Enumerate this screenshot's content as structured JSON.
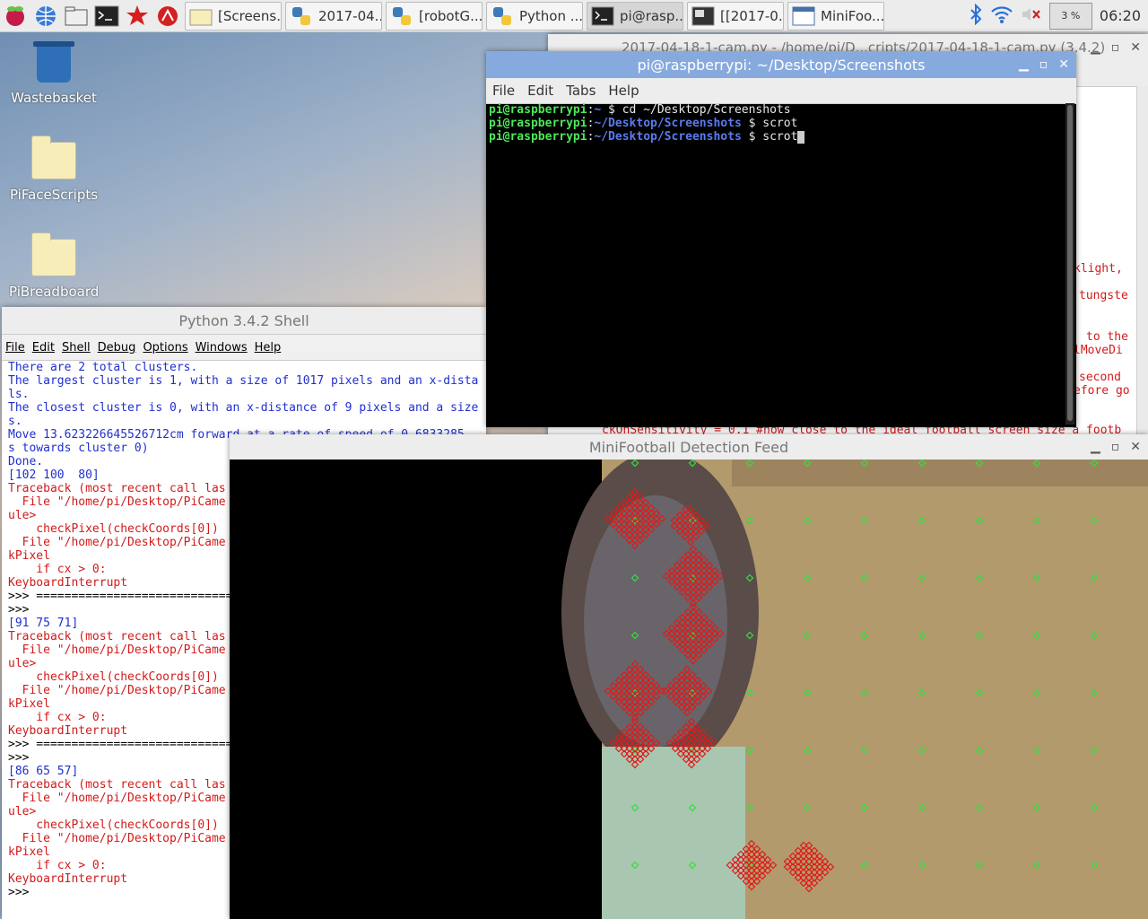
{
  "taskbar": {
    "tasks": [
      {
        "label": "[Screens...",
        "icon": "folder-icon"
      },
      {
        "label": "2017-04...",
        "icon": "python-icon"
      },
      {
        "label": "[robotG...",
        "icon": "python-icon"
      },
      {
        "label": "Python ...",
        "icon": "python-icon"
      },
      {
        "label": "pi@rasp...",
        "icon": "terminal-icon"
      },
      {
        "label": "[[2017-0...",
        "icon": "image-icon"
      },
      {
        "label": "MiniFoo...",
        "icon": "window-icon"
      }
    ],
    "cpu": "3 %",
    "clock": "06:20"
  },
  "desktop": {
    "icons": [
      {
        "label": "Wastebasket"
      },
      {
        "label": "PiFaceScripts"
      },
      {
        "label": "PiBreadboard"
      }
    ]
  },
  "editor": {
    "title": "2017-04-18-1-cam.py - /home/pi/D...cripts/2017-04-18-1-cam.py (3.4.2)",
    "visible_fragments": [
      "klight,",
      "tungste",
      "to the",
      "lMoveDi",
      "second",
      "efore go"
    ],
    "bottom_line": "ckOnSensitivity = 0.1 #now close to the ideal football screen size a footb"
  },
  "terminal": {
    "title": "pi@raspberrypi: ~/Desktop/Screenshots",
    "menu": [
      "File",
      "Edit",
      "Tabs",
      "Help"
    ],
    "lines": [
      {
        "user": "pi@raspberrypi",
        "path": "~",
        "cmd": "cd ~/Desktop/Screenshots"
      },
      {
        "user": "pi@raspberrypi",
        "path": "~/Desktop/Screenshots",
        "cmd": "scrot"
      },
      {
        "user": "pi@raspberrypi",
        "path": "~/Desktop/Screenshots",
        "cmd": "scrot"
      }
    ]
  },
  "shell": {
    "title": "Python 3.4.2 Shell",
    "menu": [
      "File",
      "Edit",
      "Shell",
      "Debug",
      "Options",
      "Windows",
      "Help"
    ],
    "lines": [
      {
        "t": "There are 2 total clusters.",
        "c": "blue"
      },
      {
        "t": "The largest cluster is 1, with a size of 1017 pixels and an x-dista",
        "c": "blue"
      },
      {
        "t": "ls.",
        "c": "blue"
      },
      {
        "t": "The closest cluster is 0, with an x-distance of 9 pixels and a size",
        "c": "blue"
      },
      {
        "t": "s.",
        "c": "blue"
      },
      {
        "t": "Move 13.623226645526712cm forward at a rate of speed of 0.6833285",
        "c": "blue"
      },
      {
        "t": "s towards cluster 0)",
        "c": "blue"
      },
      {
        "t": "Done.",
        "c": "blue"
      },
      {
        "t": "[102 100  80]",
        "c": "blue"
      },
      {
        "t": "Traceback (most recent call las",
        "c": "red"
      },
      {
        "t": "  File \"/home/pi/Desktop/PiCame",
        "c": "red"
      },
      {
        "t": "ule>",
        "c": "red"
      },
      {
        "t": "    checkPixel(checkCoords[0])",
        "c": "red"
      },
      {
        "t": "  File \"/home/pi/Desktop/PiCame",
        "c": "red"
      },
      {
        "t": "kPixel",
        "c": "red"
      },
      {
        "t": "    if cx > 0:",
        "c": "red"
      },
      {
        "t": "KeyboardInterrupt",
        "c": "red"
      },
      {
        "t": ">>> =============================",
        "c": "black"
      },
      {
        "t": ">>>",
        "c": "black"
      },
      {
        "t": "[91 75 71]",
        "c": "blue"
      },
      {
        "t": "Traceback (most recent call las",
        "c": "red"
      },
      {
        "t": "  File \"/home/pi/Desktop/PiCame",
        "c": "red"
      },
      {
        "t": "ule>",
        "c": "red"
      },
      {
        "t": "    checkPixel(checkCoords[0])",
        "c": "red"
      },
      {
        "t": "  File \"/home/pi/Desktop/PiCame",
        "c": "red"
      },
      {
        "t": "kPixel",
        "c": "red"
      },
      {
        "t": "    if cx > 0:",
        "c": "red"
      },
      {
        "t": "KeyboardInterrupt",
        "c": "red"
      },
      {
        "t": ">>> =============================",
        "c": "black"
      },
      {
        "t": ">>>",
        "c": "black"
      },
      {
        "t": "[86 65 57]",
        "c": "blue"
      },
      {
        "t": "Traceback (most recent call las",
        "c": "red"
      },
      {
        "t": "  File \"/home/pi/Desktop/PiCame",
        "c": "red"
      },
      {
        "t": "ule>",
        "c": "red"
      },
      {
        "t": "    checkPixel(checkCoords[0])",
        "c": "red"
      },
      {
        "t": "  File \"/home/pi/Desktop/PiCame",
        "c": "red"
      },
      {
        "t": "kPixel",
        "c": "red"
      },
      {
        "t": "    if cx > 0:",
        "c": "red"
      },
      {
        "t": "KeyboardInterrupt",
        "c": "red"
      },
      {
        "t": ">>>",
        "c": "black"
      }
    ]
  },
  "feed": {
    "title": "MiniFootball Detection Feed"
  },
  "colors": {
    "accent_titlebar": "#87aade",
    "term_user": "#4ee85a",
    "term_path": "#5a7bf0",
    "shell_output": "#1f2fcf",
    "shell_error": "#d21a1a"
  }
}
